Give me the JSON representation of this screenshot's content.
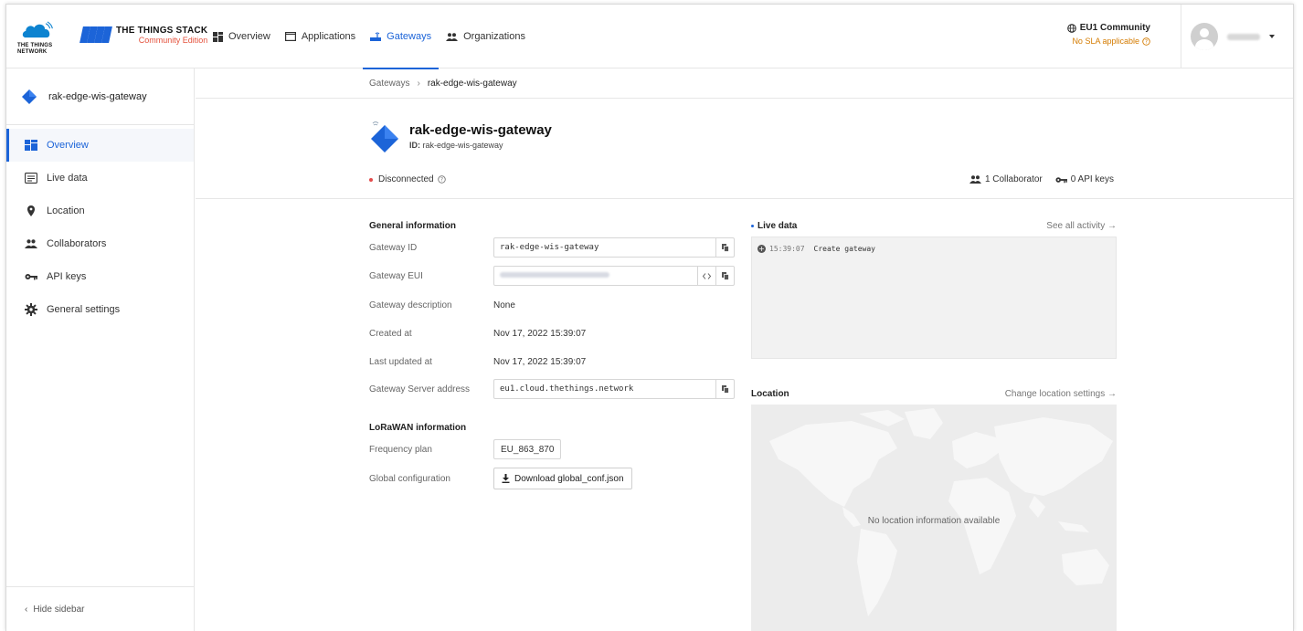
{
  "brand": {
    "ttn_line1": "THE THINGS",
    "ttn_line2": "NETWORK",
    "stack_title": "THE THINGS STACK",
    "stack_edition": "Community Edition"
  },
  "nav": {
    "items": [
      {
        "label": "Overview",
        "icon": "grid-icon"
      },
      {
        "label": "Applications",
        "icon": "window-icon"
      },
      {
        "label": "Gateways",
        "icon": "gateway-icon",
        "active": true
      },
      {
        "label": "Organizations",
        "icon": "people-icon"
      }
    ]
  },
  "cluster": {
    "name": "EU1 Community",
    "sla": "No SLA applicable"
  },
  "sidebar": {
    "gateway_name": "rak-edge-wis-gateway",
    "items": [
      {
        "label": "Overview",
        "icon": "grid-icon",
        "active": true
      },
      {
        "label": "Live data",
        "icon": "list-icon"
      },
      {
        "label": "Location",
        "icon": "pin-icon"
      },
      {
        "label": "Collaborators",
        "icon": "people-icon"
      },
      {
        "label": "API keys",
        "icon": "key-icon"
      },
      {
        "label": "General settings",
        "icon": "gear-icon"
      }
    ],
    "hide_label": "Hide sidebar"
  },
  "breadcrumb": {
    "root": "Gateways",
    "current": "rak-edge-wis-gateway"
  },
  "gateway": {
    "title": "rak-edge-wis-gateway",
    "id_label": "ID:",
    "id_value": "rak-edge-wis-gateway",
    "status": "Disconnected",
    "collaborators": "1 Collaborator",
    "api_keys": "0 API keys"
  },
  "general": {
    "title": "General information",
    "gateway_id_label": "Gateway ID",
    "gateway_id": "rak-edge-wis-gateway",
    "gateway_eui_label": "Gateway EUI",
    "description_label": "Gateway description",
    "description": "None",
    "created_label": "Created at",
    "created": "Nov 17, 2022 15:39:07",
    "updated_label": "Last updated at",
    "updated": "Nov 17, 2022 15:39:07",
    "server_label": "Gateway Server address",
    "server": "eu1.cloud.thethings.network"
  },
  "lorawan": {
    "title": "LoRaWAN information",
    "freq_label": "Frequency plan",
    "freq": "EU_863_870",
    "global_label": "Global configuration",
    "download_label": "Download global_conf.json"
  },
  "live": {
    "title": "Live data",
    "link": "See all activity →",
    "events": [
      {
        "time": "15:39:07",
        "text": "Create gateway"
      }
    ]
  },
  "location": {
    "title": "Location",
    "link": "Change location settings →",
    "empty": "No location information available"
  },
  "colors": {
    "accent": "#1c64d8",
    "status_red": "#e34b4b",
    "sla_orange": "#d47b00"
  }
}
